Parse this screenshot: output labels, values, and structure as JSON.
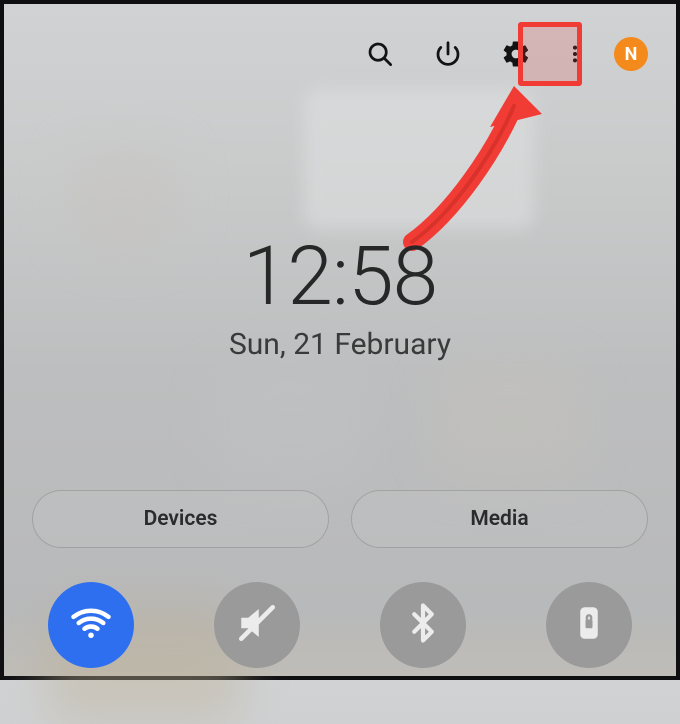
{
  "topbar": {
    "profile_initial": "N"
  },
  "clock": {
    "time": "12:58",
    "date": "Sun, 21 February"
  },
  "chips": {
    "devices_label": "Devices",
    "media_label": "Media"
  },
  "colors": {
    "highlight": "#f13c35",
    "accent_on": "#2e6ff0",
    "accent_off": "#9a9a9a",
    "profile_badge": "#f48a1b"
  },
  "quick_settings": [
    {
      "name": "wifi",
      "enabled": true
    },
    {
      "name": "mute",
      "enabled": false
    },
    {
      "name": "bluetooth",
      "enabled": false
    },
    {
      "name": "rotation-lock",
      "enabled": false
    }
  ]
}
